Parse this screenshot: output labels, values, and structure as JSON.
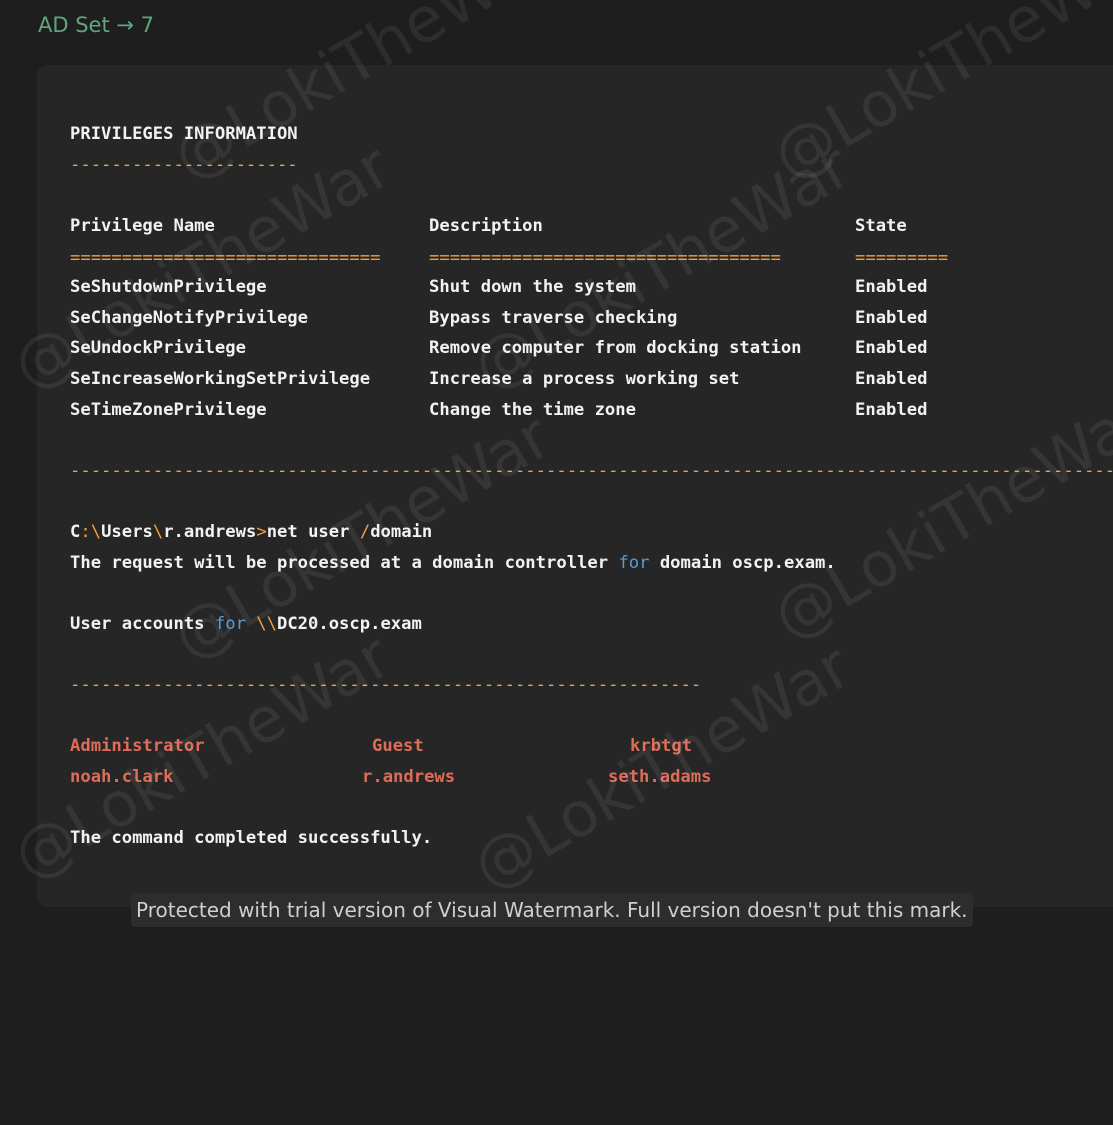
{
  "heading": "AD Set → 7",
  "privileges": {
    "title": "PRIVILEGES INFORMATION",
    "title_rule": "----------------------",
    "headers": {
      "name": "Privilege Name",
      "description": "Description",
      "state": "State"
    },
    "header_rules": {
      "name": "==============================",
      "description": "==================================",
      "state": "========="
    },
    "rows": [
      {
        "name": "SeShutdownPrivilege",
        "description": "Shut down the system",
        "state": "Enabled"
      },
      {
        "name": "SeChangeNotifyPrivilege",
        "description": "Bypass traverse checking",
        "state": "Enabled"
      },
      {
        "name": "SeUndockPrivilege",
        "description": "Remove computer from docking station",
        "state": "Enabled"
      },
      {
        "name": "SeIncreaseWorkingSetPrivilege",
        "description": "Increase a process working set",
        "state": "Enabled"
      },
      {
        "name": "SeTimeZonePrivilege",
        "description": "Change the time zone",
        "state": "Enabled"
      }
    ]
  },
  "long_rule": "-----------------------------------------------------------------------------------------------------",
  "command": {
    "drive": "C",
    "colon": ":",
    "sep1": "\\",
    "dir1": "Users",
    "sep2": "\\",
    "dir2": "r.andrews",
    "prompt": ">",
    "cmd_a": "net user ",
    "slash": "/",
    "cmd_b": "domain"
  },
  "request_line": {
    "before": "The request will be processed at a domain controller ",
    "keyword": "for",
    "after": " domain oscp.exam."
  },
  "accounts_line": {
    "before": "User accounts ",
    "keyword": "for",
    "unc": " \\\\",
    "after": "DC20.oscp.exam"
  },
  "users_rule": "-------------------------------------------------------------",
  "users": [
    [
      "Administrator",
      "Guest",
      "krbtgt"
    ],
    [
      "noah.clark",
      "r.andrews",
      "seth.adams"
    ]
  ],
  "completed": "The command completed successfully.",
  "watermark_text": "@LokiTheWar",
  "trial_notice": "Protected with trial version of Visual Watermark. Full version doesn't put this mark."
}
